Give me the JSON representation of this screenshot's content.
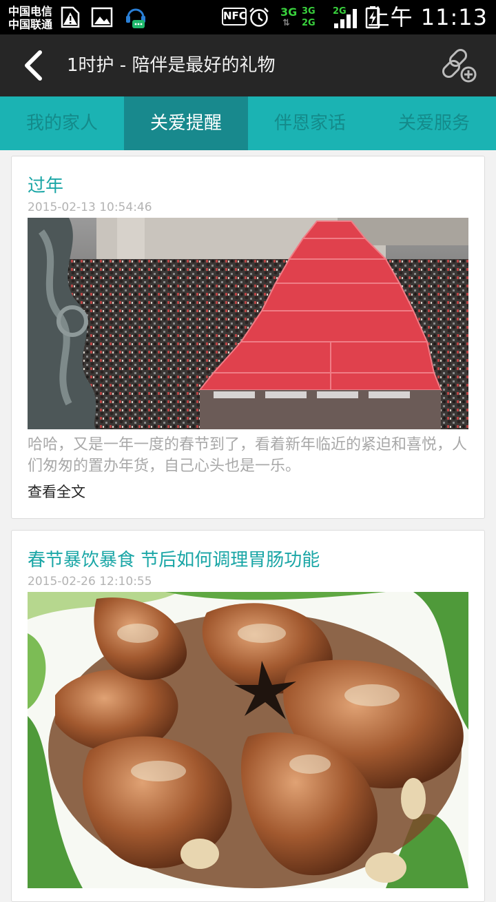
{
  "status_bar": {
    "carrier_1": "中国电信",
    "carrier_2": "中国联通",
    "nfc_label": "NFC",
    "net_3g": "3G",
    "net_3g_small": "3G",
    "net_2g_small": "2G",
    "net_2g_top": "2G",
    "time": "上午 11:13",
    "icons": [
      "sim-warning-icon",
      "image-icon",
      "chat-notification-icon",
      "nfc-icon",
      "alarm-icon",
      "signal-icon",
      "battery-icon"
    ]
  },
  "header": {
    "title": "1时护 - 陪伴是最好的礼物",
    "back_icon": "back-arrow-icon",
    "action_icon": "link-add-icon"
  },
  "tabs": [
    {
      "label": "我的家人",
      "active": false
    },
    {
      "label": "关爱提醒",
      "active": true
    },
    {
      "label": "伴恩家话",
      "active": false
    },
    {
      "label": "关爱服务",
      "active": false
    }
  ],
  "articles": [
    {
      "title": "过年",
      "date": "2015-02-13 10:54:46",
      "image": "crowded-market-with-red-tents",
      "desc": "哈哈，又是一年一度的春节到了，看着新年临近的紧迫和喜悦，人们匆匆的置办年货，自己心头也是一乐。",
      "more": "查看全文"
    },
    {
      "title": "春节暴饮暴食 节后如何调理胃肠功能",
      "date": "2015-02-26 12:10:55",
      "image": "braised-pork-trotters-on-greens"
    }
  ],
  "colors": {
    "accent": "#1bb3b3",
    "tab_active": "#18898d",
    "header_bg": "#262626",
    "title_text": "#1aa6a6"
  }
}
